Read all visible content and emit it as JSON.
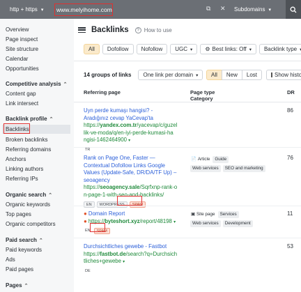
{
  "topbar": {
    "protocol": "http + https",
    "url_value": "www.melyihome.com",
    "subdomains": "Subdomains"
  },
  "sidebar": {
    "items_top": [
      "Overview",
      "Page inspect",
      "Site structure",
      "Calendar",
      "Opportunities"
    ],
    "competitive_heading": "Competitive analysis",
    "competitive_items": [
      "Content gap",
      "Link intersect"
    ],
    "backlink_heading": "Backlink profile",
    "backlink_items": [
      "Backlinks",
      "Broken backlinks",
      "Referring domains",
      "Anchors",
      "Linking authors",
      "Referring IPs"
    ],
    "organic_heading": "Organic search",
    "organic_items": [
      "Organic keywords",
      "Top pages",
      "Organic competitors"
    ],
    "paid_heading": "Paid search",
    "paid_items": [
      "Paid keywords",
      "Ads",
      "Paid pages"
    ],
    "pages_heading": "Pages"
  },
  "header": {
    "title": "Backlinks",
    "howto": "How to use"
  },
  "filters": {
    "all": "All",
    "dofollow": "Dofollow",
    "nofollow": "Nofollow",
    "ugc": "UGC",
    "best_links": "Best links: Off",
    "backlink_type": "Backlink type"
  },
  "toolbar": {
    "groups_label": "14 groups of links",
    "per_domain": "One link per domain",
    "seg_all": "All",
    "seg_new": "New",
    "seg_lost": "Lost",
    "show_history": "Show history"
  },
  "table": {
    "col_ref": "Referring page",
    "col_type_1": "Page type",
    "col_type_2": "Category",
    "col_dr": "DR",
    "rows": [
      {
        "title": "Uyn perde kumaşı hangisi? - Aradığınız cevap YaCevap'ta",
        "title_lines": [
          "Uyn perde kumaşı hangisi? -",
          "Aradığınız cevap YaCevap'ta"
        ],
        "url_lines": [
          "https://yandex.com.tr/yacevap/c/guzel",
          "lik-ve-moda/q/en-iyi-perde-kumasi-ha",
          "ngisi-1462464900"
        ],
        "url_domain": "yandex.com.tr",
        "lang": "TR",
        "dr": "86"
      },
      {
        "title_lines": [
          "Rank on Page One, Faster —",
          "Contextual Dofollow Links Google",
          "Values (Update-Safe, DR/DA/TF Up) –",
          "seoagency"
        ],
        "url_lines": [
          "https://seoagency.sale/Sqrfxnp-rank-o",
          "n-page-1-with-seo-and-backlinks/"
        ],
        "lang": "EN",
        "tag2": "WORDPRESS",
        "tag3": "SPAM",
        "article": "Article",
        "guide": "Guide",
        "cat1": "Web services",
        "cat2": "SEO and marketing",
        "dr": "76"
      },
      {
        "title": "Domain Report",
        "url_lines": [
          "https://byteshort.xyz/report/48198"
        ],
        "lang": "EN",
        "tag2": "SPAM",
        "site_page": "Site page",
        "services": "Services",
        "cat1": "Web services",
        "cat2": "Development",
        "dr": "11"
      },
      {
        "title": "Durchsichtliches gewebe - Fastbot",
        "url_lines": [
          "https://fastbot.de/search?q=Durchsich",
          "tliches+gewebe"
        ],
        "lang": "DE",
        "dr": "53"
      }
    ]
  },
  "colors": {
    "accent_red": "#e03030",
    "link_blue": "#2b5fd9",
    "url_green": "#1e8a3a",
    "active_filter": "#fbeacb"
  }
}
